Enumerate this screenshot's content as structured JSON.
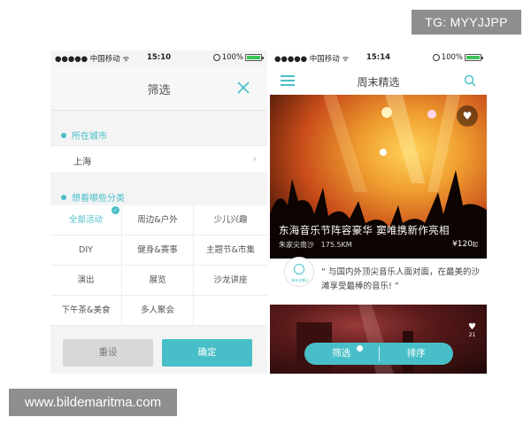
{
  "watermarks": {
    "top": "TG: MYYJJPP",
    "bottom": "www.bildemaritma.com"
  },
  "status_left": {
    "carrier": "●●●●● 中国移动 ᯤ",
    "time": "15:10",
    "battery": "100%"
  },
  "status_right": {
    "carrier": "●●●●● 中国移动 ᯤ",
    "time": "15:14",
    "battery": "100%"
  },
  "filter": {
    "title": "筛选",
    "city_label": "所在城市",
    "city_value": "上海",
    "category_label": "想看哪些分类",
    "categories": [
      "全部活动",
      "周边&户外",
      "少儿兴趣",
      "DIY",
      "健身&赛事",
      "主题节&市集",
      "演出",
      "展览",
      "沙龙讲座",
      "下午茶&美食",
      "多人聚会",
      ""
    ],
    "active_category": "全部活动",
    "reset_label": "重设",
    "ok_label": "确定"
  },
  "feed": {
    "title": "周末精选",
    "event_title": "东海音乐节阵容豪华 窦唯携新作亮相",
    "event_location": "朱家尖南沙",
    "event_distance": "175.5KM",
    "event_price": "¥120",
    "event_price_suffix": "起",
    "logo_text": "周末去哪儿",
    "quote": "“ 与国内外顶尖音乐人面对面，在最美的沙滩享受最棒的音乐! ”",
    "like_count": "21",
    "filter_button": "筛选",
    "sort_button": "排序"
  },
  "colors": {
    "accent": "#48bfc8",
    "reset_bg": "#d8d8d8",
    "watermark_bg": "#8e8e8e"
  }
}
